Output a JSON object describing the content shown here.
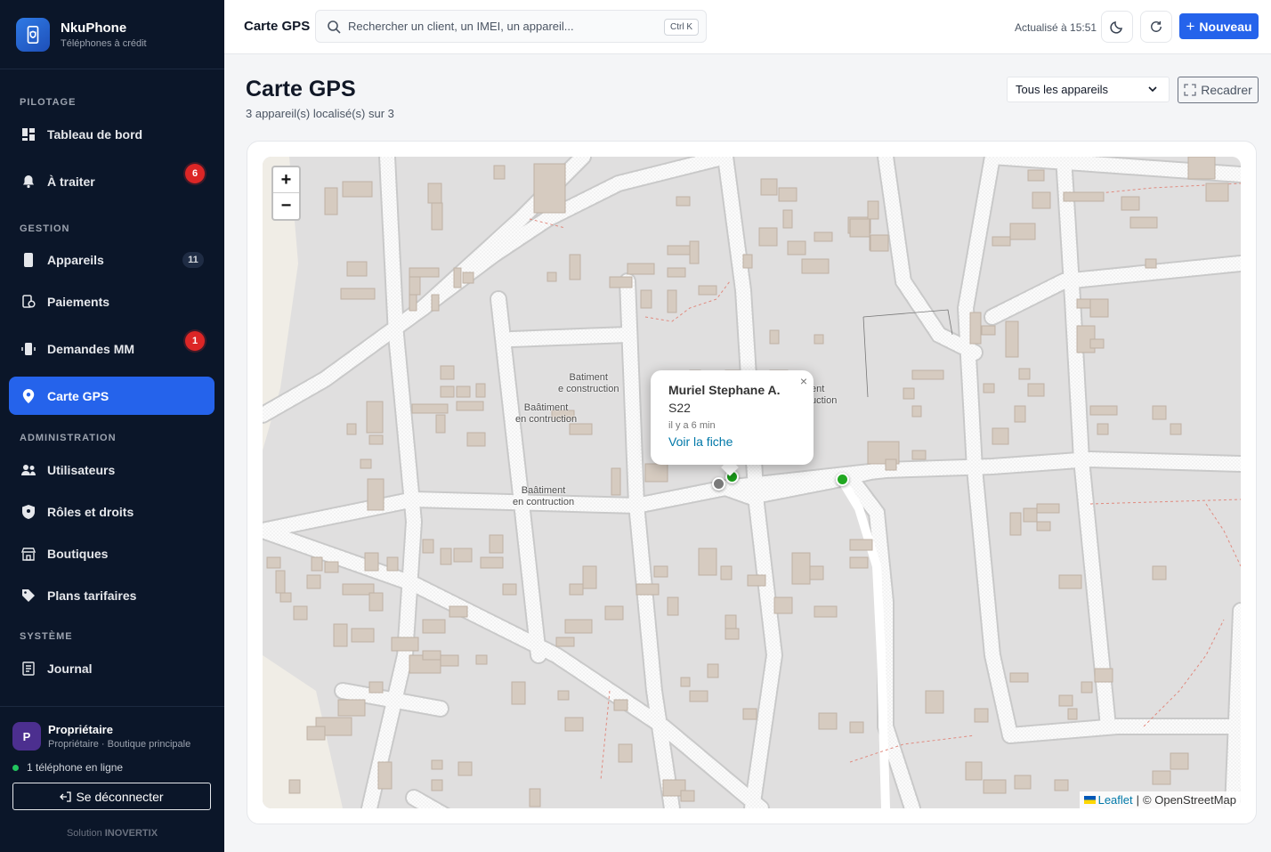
{
  "brand": {
    "name": "NkuPhone",
    "subtitle": "Téléphones à crédit"
  },
  "sidebar": {
    "sections": [
      {
        "label": "PILOTAGE"
      },
      {
        "label": "GESTION"
      },
      {
        "label": "ADMINISTRATION"
      },
      {
        "label": "SYSTÈME"
      }
    ],
    "items": [
      {
        "label": "Tableau de bord",
        "icon": "dashboard-icon"
      },
      {
        "label": "À traiter",
        "icon": "bell-icon",
        "badge": "6"
      },
      {
        "label": "Appareils",
        "icon": "phone-icon",
        "badge": "11"
      },
      {
        "label": "Paiements",
        "icon": "payment-icon"
      },
      {
        "label": "Demandes MM",
        "icon": "mobile-money-icon",
        "badge": "1"
      },
      {
        "label": "Carte GPS",
        "icon": "map-pin-icon"
      },
      {
        "label": "Utilisateurs",
        "icon": "users-icon"
      },
      {
        "label": "Rôles et droits",
        "icon": "shield-icon"
      },
      {
        "label": "Boutiques",
        "icon": "store-icon"
      },
      {
        "label": "Plans tarifaires",
        "icon": "tag-icon"
      },
      {
        "label": "Journal",
        "icon": "journal-icon"
      }
    ],
    "user": {
      "initial": "P",
      "name": "Propriétaire",
      "role": "Propriétaire · Boutique principale"
    },
    "online": "1 téléphone en ligne",
    "logout_label": "Se déconnecter",
    "solution": "Solution ",
    "solution_brand": "INOVERTIX"
  },
  "topbar": {
    "title": "Carte GPS",
    "search_placeholder": "Rechercher un client, un IMEI, un appareil...",
    "shortcut": "Ctrl K",
    "updated": "Actualisé à 15:51",
    "new_label": "Nouveau"
  },
  "main": {
    "title": "Carte GPS",
    "subtitle": "3 appareil(s) localisé(s) sur 3",
    "filter_value": "Tous les appareils",
    "recenter_label": "Recadrer"
  },
  "map": {
    "zoom_in": "+",
    "zoom_out": "−",
    "popup": {
      "name": "Muriel Stephane A.",
      "model": "S22",
      "time": "il y a 6 min",
      "link": "Voir la fiche",
      "close": "×"
    },
    "labels": [
      {
        "l1": "Batiment",
        "l2": "e construction"
      },
      {
        "l1": "Baâtiment",
        "l2": "en contruction"
      },
      {
        "l1": "Baâtiment",
        "l2": "en contruction"
      },
      {
        "l1": "ent",
        "l2": "uction"
      }
    ],
    "markers": [
      {
        "status": "offline",
        "color": "#7a7a7a"
      },
      {
        "status": "online",
        "color": "#1a9c1a"
      },
      {
        "status": "online",
        "color": "#22a822"
      }
    ],
    "attribution": {
      "leaflet": "Leaflet",
      "sep": "|",
      "osm": "© OpenStreetMap"
    }
  },
  "colors": {
    "sidebar_bg": "#0b1629",
    "accent": "#2563eb",
    "badge": "#dc2626"
  }
}
